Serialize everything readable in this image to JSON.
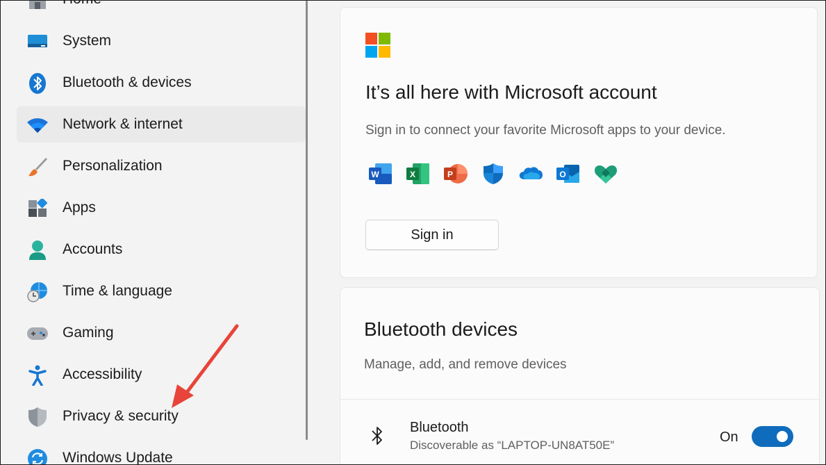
{
  "sidebar": {
    "items": [
      {
        "label": "Home",
        "icon": "home-icon"
      },
      {
        "label": "System",
        "icon": "system-icon"
      },
      {
        "label": "Bluetooth & devices",
        "icon": "bluetooth-icon"
      },
      {
        "label": "Network & internet",
        "icon": "wifi-icon",
        "active": true
      },
      {
        "label": "Personalization",
        "icon": "brush-icon"
      },
      {
        "label": "Apps",
        "icon": "apps-icon"
      },
      {
        "label": "Accounts",
        "icon": "accounts-icon"
      },
      {
        "label": "Time & language",
        "icon": "globe-clock-icon"
      },
      {
        "label": "Gaming",
        "icon": "gamepad-icon"
      },
      {
        "label": "Accessibility",
        "icon": "accessibility-icon"
      },
      {
        "label": "Privacy & security",
        "icon": "shield-icon"
      },
      {
        "label": "Windows Update",
        "icon": "update-icon"
      }
    ]
  },
  "account_card": {
    "title": "It’s all here with Microsoft account",
    "subtitle": "Sign in to connect your favorite Microsoft apps to your device.",
    "apps": [
      "word-icon",
      "excel-icon",
      "powerpoint-icon",
      "defender-icon",
      "onedrive-icon",
      "outlook-icon",
      "family-icon"
    ],
    "signin_label": "Sign in"
  },
  "bluetooth_card": {
    "title": "Bluetooth devices",
    "subtitle": "Manage, add, and remove devices",
    "row_label": "Bluetooth",
    "row_sub": "Discoverable as “LAPTOP-UN8AT50E”",
    "state_label": "On",
    "enabled": true
  },
  "colors": {
    "accent": "#0f6cbd",
    "annotation_arrow": "#e8443a"
  }
}
